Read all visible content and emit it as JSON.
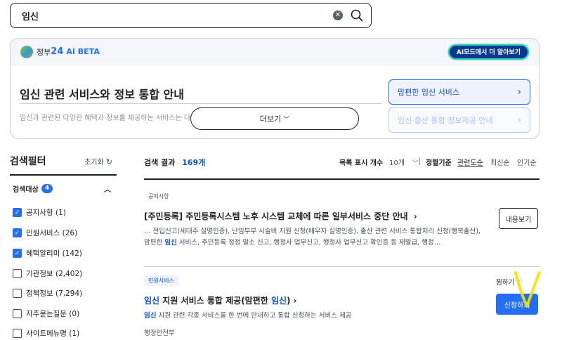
{
  "search": {
    "value": "임신"
  },
  "ai": {
    "brand": "정부",
    "brand_num": "24",
    "beta": "AI BETA",
    "more_ai": "AI모드에서 더 알아보기",
    "title": "임신 관련 서비스와 정보 통합 안내",
    "desc": "임신과 관련된 다양한 혜택과 정보를 제공하는 서비스는 다",
    "more_btn": "더보기",
    "links": [
      "맘편한 임신 서비스",
      "임신·출산 통합 정보제공 안내"
    ]
  },
  "filter": {
    "title": "검색필터",
    "reset": "초기화",
    "target_label": "검색대상",
    "target_count": "4",
    "options": [
      {
        "label": "공지사항 (1)",
        "checked": true
      },
      {
        "label": "민원서비스 (26)",
        "checked": true
      },
      {
        "label": "혜택알리미 (142)",
        "checked": true
      },
      {
        "label": "기관정보 (2,402)",
        "checked": false
      },
      {
        "label": "정책정보 (7,294)",
        "checked": false
      },
      {
        "label": "자주묻는질문 (0)",
        "checked": false
      },
      {
        "label": "사이트메뉴명 (1)",
        "checked": false
      }
    ]
  },
  "results": {
    "label": "검색 결과",
    "count": "169개",
    "list_size_label": "목록 표시 개수",
    "list_size_value": "10개",
    "sort_label": "정렬기준",
    "sort_options": [
      "관련도순",
      "최신순",
      "인기순"
    ]
  },
  "items": [
    {
      "tag": "공지사항",
      "title": "[주민등록] 주민등록시스템 노후 시스템 교체에 따른 일부서비스 중단 안내",
      "desc_before": "… 전입신고(세대주 실명인증), 난임부부 시술비 지원 신청(배우자 실명인증), 출산 관련 서비스 통합처리 신청(행복출산), 맘편한 ",
      "desc_hl": "임신",
      "desc_after": " 서비스, 주민등록 정정 말소 신고, 행정사 업무신고, 행정사 업무신고 확인증 등 재발급, 행정…",
      "button": "내용보기"
    },
    {
      "tag": "민원서비스",
      "title_hl": "임신",
      "title_mid": " 지원 서비스 통합 제공(맘편한 ",
      "title_hl2": "임신",
      "title_end": ")",
      "desc_hl": "임신",
      "desc_after": " 지원 관련 각종 서비스를 한 번에 안내하고 통합 신청하는 서비스 제공",
      "dept": "행정안전부",
      "fav": "찜하기",
      "button": "신청하기"
    }
  ],
  "colors": {
    "primary": "#256ef4",
    "highlight": "#0b50d0",
    "annotation": "#f5e100"
  }
}
